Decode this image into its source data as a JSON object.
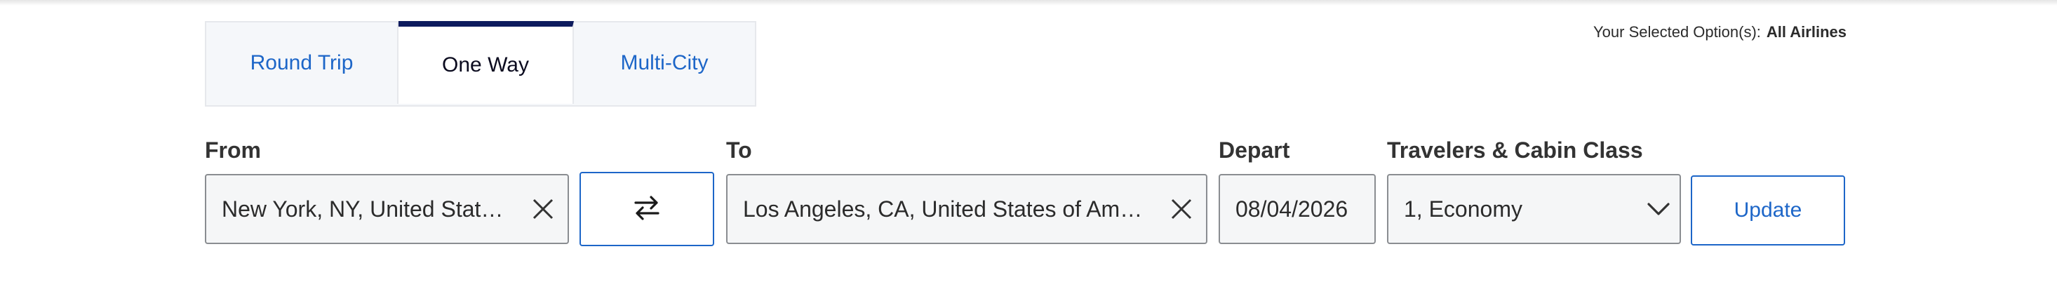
{
  "selected_options": {
    "label": "Your Selected Option(s):",
    "value": "All Airlines"
  },
  "trip_tabs": [
    {
      "label": "Round Trip",
      "selected": false
    },
    {
      "label": "One Way",
      "selected": true
    },
    {
      "label": "Multi-City",
      "selected": false
    }
  ],
  "search": {
    "from_label": "From",
    "from_value": "New York, NY, United Stat…",
    "to_label": "To",
    "to_value": "Los Angeles, CA, United States of Am…",
    "depart_label": "Depart",
    "depart_value": "08/04/2026",
    "travelers_label": "Travelers & Cabin Class",
    "travelers_value": "1, Economy",
    "update_label": "Update"
  },
  "icons": {
    "clear": "close-icon",
    "swap": "swap-icon",
    "dropdown": "chevron-down-icon"
  },
  "colors": {
    "accent": "#1d66c8",
    "tab_indicator": "#0d1b5e",
    "field_border": "#8a8d91",
    "field_bg": "#f5f6f7"
  }
}
